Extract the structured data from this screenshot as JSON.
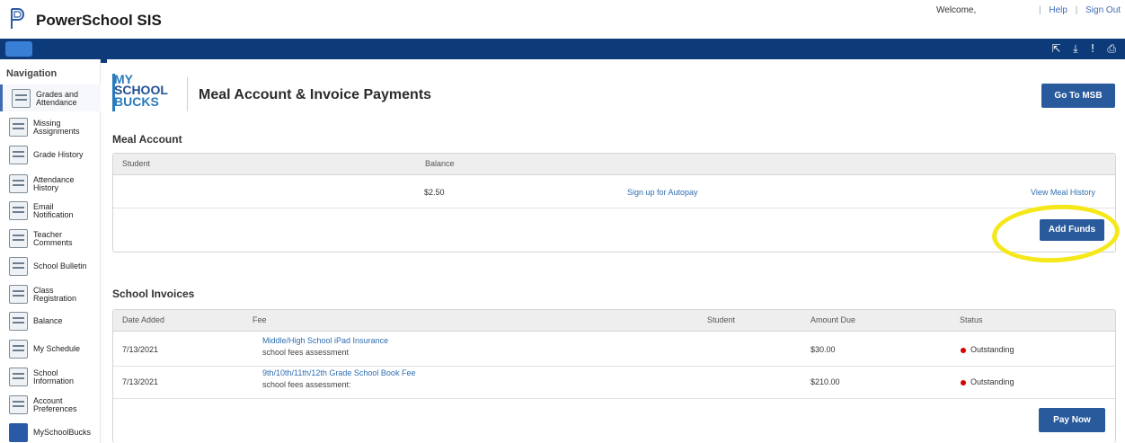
{
  "header": {
    "brand": "PowerSchool SIS",
    "welcome": "Welcome,",
    "links": {
      "help": "Help",
      "sign_out": "Sign Out"
    },
    "logo_icon": "powerschool-p-icon"
  },
  "toolbar": {
    "icons": [
      "external-link-icon",
      "download-icon",
      "alert-icon",
      "print-icon"
    ],
    "glyphs": [
      "⇱",
      "⤓",
      "!",
      "⎙"
    ]
  },
  "sidebar": {
    "title": "Navigation",
    "items": [
      {
        "label_1": "Grades and",
        "label_2": "Attendance",
        "icon": "grades-icon"
      },
      {
        "label_1": "Missing",
        "label_2": "Assignments",
        "icon": "missing-assignments-icon"
      },
      {
        "label_1": "Grade History",
        "label_2": "",
        "icon": "grade-history-icon"
      },
      {
        "label_1": "Attendance",
        "label_2": "History",
        "icon": "attendance-history-icon"
      },
      {
        "label_1": "Email",
        "label_2": "Notification",
        "icon": "email-icon"
      },
      {
        "label_1": "Teacher",
        "label_2": "Comments",
        "icon": "comments-icon"
      },
      {
        "label_1": "School Bulletin",
        "label_2": "",
        "icon": "bulletin-icon"
      },
      {
        "label_1": "Class",
        "label_2": "Registration",
        "icon": "class-registration-icon"
      },
      {
        "label_1": "Balance",
        "label_2": "",
        "icon": "balance-icon"
      },
      {
        "label_1": "My Schedule",
        "label_2": "",
        "icon": "schedule-icon"
      },
      {
        "label_1": "School",
        "label_2": "Information",
        "icon": "school-info-icon"
      },
      {
        "label_1": "Account",
        "label_2": "Preferences",
        "icon": "account-preferences-icon"
      },
      {
        "label_1": "MySchoolBucks",
        "label_2": "",
        "icon": "myschoolbucks-icon"
      }
    ]
  },
  "main": {
    "logo": {
      "l1": "MY",
      "l2": "SCHOOL",
      "l3": "BUCKS"
    },
    "title": "Meal Account & Invoice Payments",
    "go_to_msb": "Go To MSB",
    "meal": {
      "section_title": "Meal Account",
      "headers": {
        "student": "Student",
        "balance": "Balance"
      },
      "row": {
        "student": "",
        "balance": "$2.50",
        "autopay_link": "Sign up for Autopay",
        "history_link": "View Meal History"
      },
      "add_funds": "Add Funds"
    },
    "invoices": {
      "section_title": "School Invoices",
      "headers": {
        "date": "Date Added",
        "fee": "Fee",
        "student": "Student",
        "amount": "Amount Due",
        "status": "Status"
      },
      "rows": [
        {
          "date": "7/13/2021",
          "fee": "Middle/High School iPad Insurance",
          "fee_sub": "school fees assessment",
          "student": "",
          "amount": "$30.00",
          "status": "Outstanding"
        },
        {
          "date": "7/13/2021",
          "fee": "9th/10th/11th/12th Grade School Book Fee",
          "fee_sub": "school fees assessment:",
          "student": "",
          "amount": "$210.00",
          "status": "Outstanding"
        }
      ],
      "pay_now": "Pay Now"
    },
    "colors": {
      "navbar": "#0d3b79",
      "button": "#285a9c",
      "link": "#2f6fb0",
      "status_outstanding": "#d40000",
      "highlight": "#f5e81a"
    }
  }
}
